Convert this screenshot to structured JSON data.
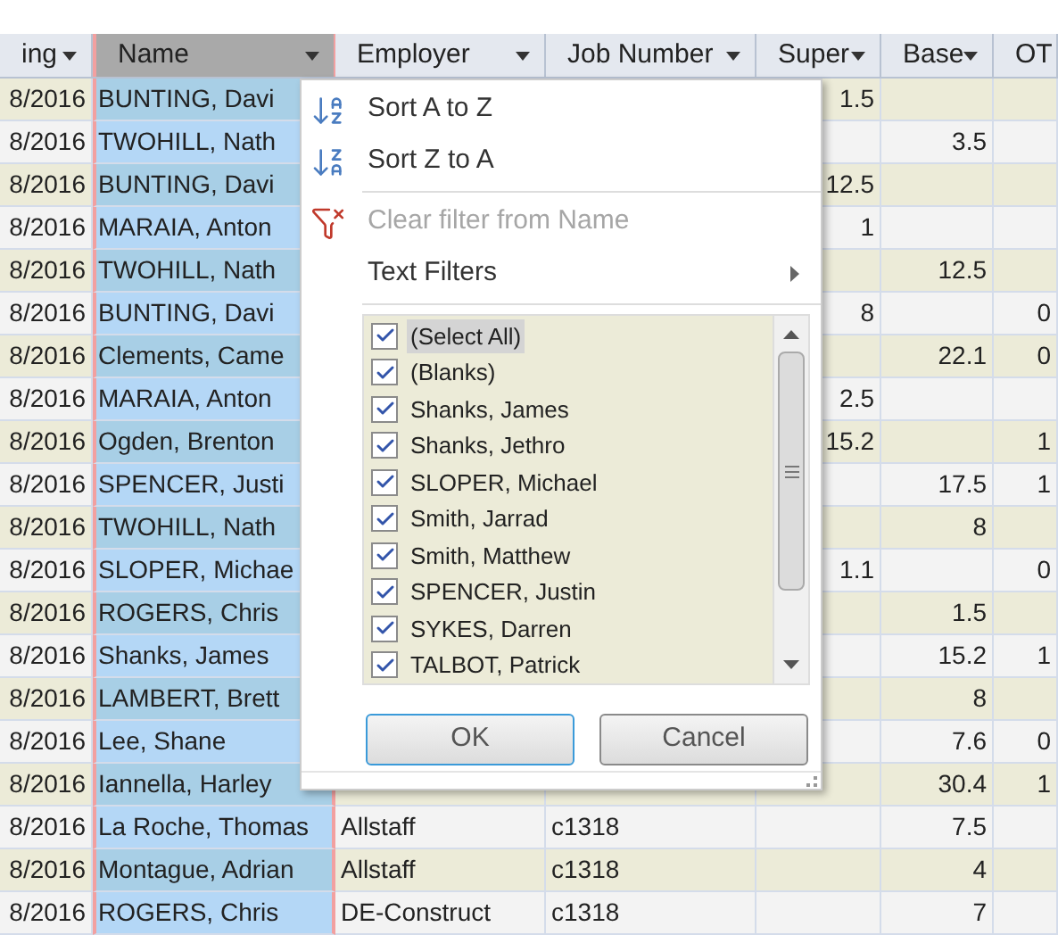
{
  "columns": [
    {
      "label": "ing",
      "selected": false,
      "dropdown": true
    },
    {
      "label": "Name",
      "selected": true,
      "dropdown": true
    },
    {
      "label": "Employer",
      "selected": false,
      "dropdown": true
    },
    {
      "label": "Job Number",
      "selected": false,
      "dropdown": true
    },
    {
      "label": "Super",
      "selected": false,
      "dropdown": true
    },
    {
      "label": "Base",
      "selected": false,
      "dropdown": true
    },
    {
      "label": "OT",
      "selected": false,
      "dropdown": false
    }
  ],
  "rows": [
    {
      "date": "8/2016",
      "name": "BUNTING, Davi",
      "super": "1.5"
    },
    {
      "date": "8/2016",
      "name": "TWOHILL, Nath",
      "base": "3.5"
    },
    {
      "date": "8/2016",
      "name": "BUNTING, Davi",
      "super": "12.5"
    },
    {
      "date": "8/2016",
      "name": "MARAIA, Anton",
      "super": "1"
    },
    {
      "date": "8/2016",
      "name": "TWOHILL, Nath",
      "base": "12.5"
    },
    {
      "date": "8/2016",
      "name": "BUNTING, Davi",
      "super": "8",
      "ot": "0"
    },
    {
      "date": "8/2016",
      "name": "Clements, Came",
      "base": "22.1",
      "ot": "0"
    },
    {
      "date": "8/2016",
      "name": "MARAIA, Anton",
      "super": "2.5"
    },
    {
      "date": "8/2016",
      "name": "Ogden, Brenton",
      "super": "15.2",
      "ot": "1"
    },
    {
      "date": "8/2016",
      "name": "SPENCER, Justi",
      "base": "17.5",
      "ot": "1"
    },
    {
      "date": "8/2016",
      "name": "TWOHILL, Nath",
      "base": "8"
    },
    {
      "date": "8/2016",
      "name": "SLOPER, Michae",
      "super": "1.1",
      "ot": "0"
    },
    {
      "date": "8/2016",
      "name": "ROGERS, Chris",
      "base": "1.5"
    },
    {
      "date": "8/2016",
      "name": "Shanks, James",
      "base": "15.2",
      "ot": "1"
    },
    {
      "date": "8/2016",
      "name": "LAMBERT, Brett",
      "base": "8"
    },
    {
      "date": "8/2016",
      "name": "Lee, Shane",
      "base": "7.6",
      "ot": "0"
    },
    {
      "date": "8/2016",
      "name": "Iannella, Harley",
      "base": "30.4",
      "ot": "1"
    },
    {
      "date": "8/2016",
      "name": "La Roche, Thomas",
      "employer": "Allstaff",
      "job": "c1318",
      "base": "7.5"
    },
    {
      "date": "8/2016",
      "name": "Montague, Adrian",
      "employer": "Allstaff",
      "job": "c1318",
      "base": "4"
    },
    {
      "date": "8/2016",
      "name": "ROGERS, Chris",
      "employer": "DE-Construct",
      "job": "c1318",
      "base": "7"
    }
  ],
  "filter_menu": {
    "items": [
      {
        "kind": "sort_asc",
        "label": "Sort A to Z",
        "disabled": false
      },
      {
        "kind": "sort_desc",
        "label": "Sort Z to A",
        "disabled": false
      },
      {
        "kind": "separator"
      },
      {
        "kind": "clear",
        "label": "Clear filter from Name",
        "disabled": true
      },
      {
        "kind": "submenu",
        "label": "Text Filters",
        "disabled": false
      },
      {
        "kind": "separator"
      }
    ],
    "values": [
      {
        "label": "(Select All)",
        "checked": true,
        "highlighted": true
      },
      {
        "label": "(Blanks)",
        "checked": true,
        "highlighted": false
      },
      {
        "label": "Shanks, James",
        "checked": true,
        "highlighted": false
      },
      {
        "label": "Shanks, Jethro",
        "checked": true,
        "highlighted": false
      },
      {
        "label": "SLOPER, Michael",
        "checked": true,
        "highlighted": false
      },
      {
        "label": "Smith, Jarrad",
        "checked": true,
        "highlighted": false
      },
      {
        "label": "Smith, Matthew",
        "checked": true,
        "highlighted": false
      },
      {
        "label": "SPENCER, Justin",
        "checked": true,
        "highlighted": false
      },
      {
        "label": "SYKES, Darren",
        "checked": true,
        "highlighted": false
      },
      {
        "label": "TALBOT, Patrick",
        "checked": true,
        "highlighted": false
      }
    ],
    "buttons": [
      {
        "label": "OK",
        "default": true
      },
      {
        "label": "Cancel",
        "default": false
      }
    ]
  }
}
